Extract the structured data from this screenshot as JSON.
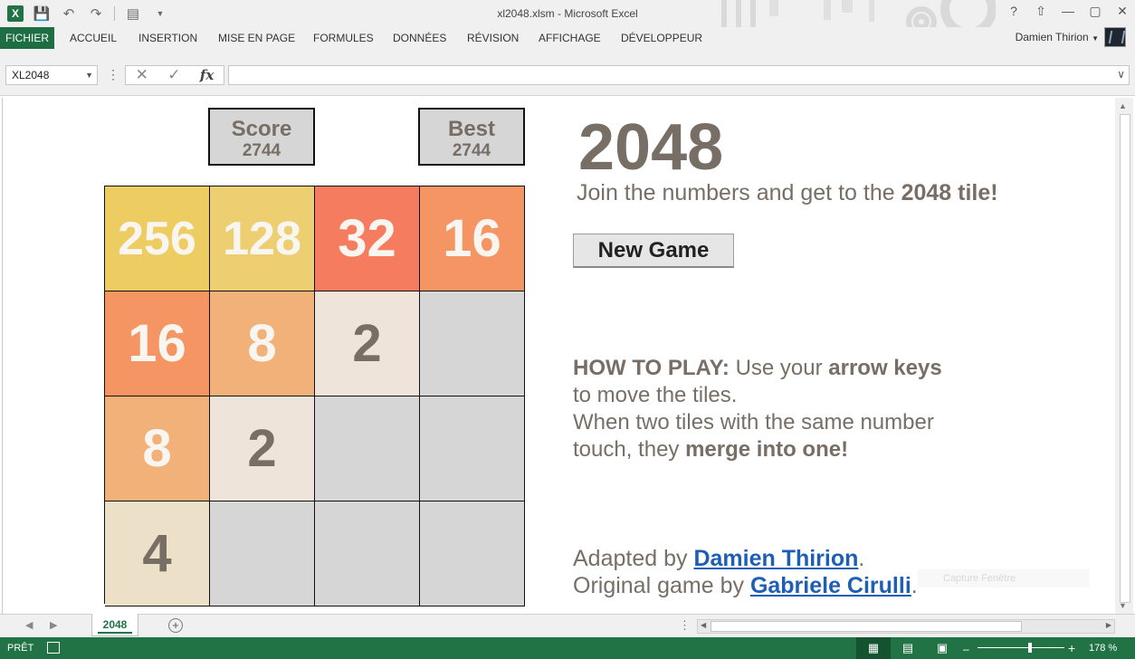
{
  "window": {
    "title": "xl2048.xlsm - Microsoft Excel",
    "help": "?",
    "minimize": "—",
    "restore": "▢",
    "close": "✕"
  },
  "ribbon": {
    "tabs": [
      "FICHIER",
      "ACCUEIL",
      "INSERTION",
      "MISE EN PAGE",
      "FORMULES",
      "DONNÉES",
      "RÉVISION",
      "AFFICHAGE",
      "DÉVELOPPEUR"
    ],
    "user": "Damien Thirion"
  },
  "formula_bar": {
    "name_box": "XL2048",
    "fx": "fx",
    "value": ""
  },
  "game": {
    "score_label": "Score",
    "score_value": "2744",
    "best_label": "Best",
    "best_value": "2744",
    "board": [
      [
        "256",
        "128",
        "32",
        "16"
      ],
      [
        "16",
        "8",
        "2",
        ""
      ],
      [
        "8",
        "2",
        "",
        ""
      ],
      [
        "4",
        "",
        "",
        ""
      ]
    ],
    "title": "2048",
    "subtitle_prefix": "Join the numbers and get to the ",
    "subtitle_bold": "2048 tile!",
    "new_game_label": "New Game",
    "howto": {
      "bold1": "HOW TO PLAY:",
      "text1": " Use your ",
      "bold2": "arrow keys",
      "line2": "to move the tiles.",
      "line3": "When two tiles with the same number",
      "line4_prefix": "touch, they ",
      "line4_bold": "merge into one!"
    },
    "credits": {
      "adapted_prefix": "Adapted by ",
      "adapted_name": "Damien Thirion",
      "adapted_suffix": ".",
      "original_prefix": "Original game by ",
      "original_name": "Gabriele Cirulli",
      "original_suffix": "."
    }
  },
  "sheet_tabs": {
    "active": "2048"
  },
  "overlay": {
    "tooltip": "Capture Fenêtre"
  },
  "status_bar": {
    "ready": "PRÊT",
    "zoom": "178 %"
  },
  "colors": {
    "excel_green": "#217346",
    "tile_text_dark": "#776e65",
    "tile_2": "#eee4da",
    "tile_4": "#ede0c8",
    "tile_8": "#f2b179",
    "tile_16": "#f59563",
    "tile_32": "#f67c5f",
    "tile_128": "#edcf72",
    "tile_256": "#edcc61",
    "empty": "#d6d6d6",
    "link": "#1e5eb5"
  }
}
